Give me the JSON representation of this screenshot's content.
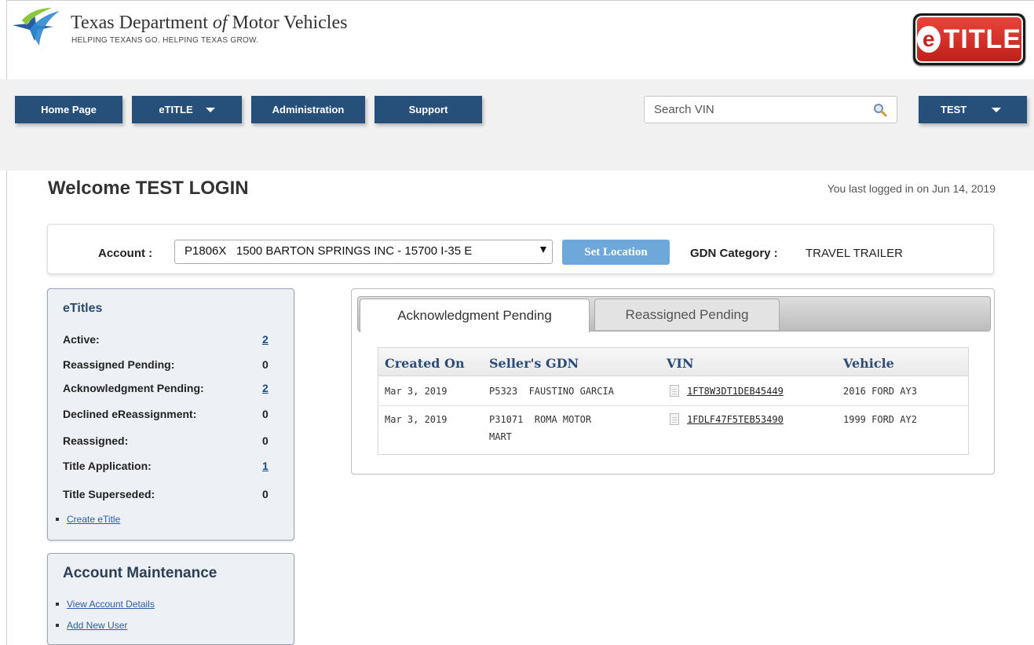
{
  "header": {
    "agency_name_pre": "Texas Department",
    "agency_name_of": "of",
    "agency_name_post": "Motor Vehicles",
    "tagline": "HELPING TEXANS GO. HELPING TEXAS GROW.",
    "badge_e": "e",
    "badge_word": "TITLE"
  },
  "nav": {
    "home": "Home Page",
    "etitle": "eTITLE",
    "administration": "Administration",
    "support": "Support",
    "search_placeholder": "Search VIN",
    "user": "TEST"
  },
  "welcome": {
    "title": "Welcome TEST LOGIN",
    "last_login": "You last logged in on Jun 14, 2019"
  },
  "account": {
    "label": "Account :",
    "selected": "P1806X   1500 BARTON SPRINGS INC - 15700 I-35 E",
    "set_location": "Set Location",
    "gdn_label": "GDN Category :",
    "gdn_value": "TRAVEL TRAILER"
  },
  "etitles_panel": {
    "title": "eTitles",
    "rows": [
      {
        "label": "Active:",
        "value": "2",
        "link": true
      },
      {
        "label": "Reassigned Pending:",
        "value": "0",
        "link": false
      },
      {
        "label": "Acknowledgment Pending:",
        "value": "2",
        "link": true
      },
      {
        "label": "Declined eReassignment:",
        "value": "0",
        "link": false
      },
      {
        "label": "Reassigned:",
        "value": "0",
        "link": false
      },
      {
        "label": "Title Application:",
        "value": "1",
        "link": true
      },
      {
        "label": "Title Superseded:",
        "value": "0",
        "link": false
      }
    ],
    "create_link": "Create eTitle"
  },
  "account_panel": {
    "title": "Account Maintenance",
    "links": [
      "View Account Details",
      "Add New User"
    ]
  },
  "tabs": {
    "active": "Acknowledgment Pending",
    "inactive": "Reassigned Pending"
  },
  "grid": {
    "headers": [
      "Created On",
      "Seller's GDN",
      "VIN",
      "Vehicle"
    ],
    "rows": [
      {
        "created": "Mar 3, 2019",
        "seller": "P5323  FAUSTINO GARCIA",
        "seller2": "",
        "vin": "1FT8W3DT1DEB45449",
        "vehicle": "2016 FORD AY3"
      },
      {
        "created": "Mar 3, 2019",
        "seller": "P31071  ROMA MOTOR",
        "seller2": "MART",
        "vin": "1FDLF47F5TEB53490",
        "vehicle": "1999 FORD AY2"
      }
    ]
  },
  "colors": {
    "nav_blue": "#264f7a",
    "button_light_blue": "#6ea8da",
    "panel_bg": "#edf0f5",
    "link_blue": "#2a5da8",
    "logo_red": "#c8241d"
  },
  "icons": {
    "logo": "txdmv-star-logo",
    "search": "search-icon",
    "doc": "document-icon",
    "caret": "chevron-down-icon"
  }
}
